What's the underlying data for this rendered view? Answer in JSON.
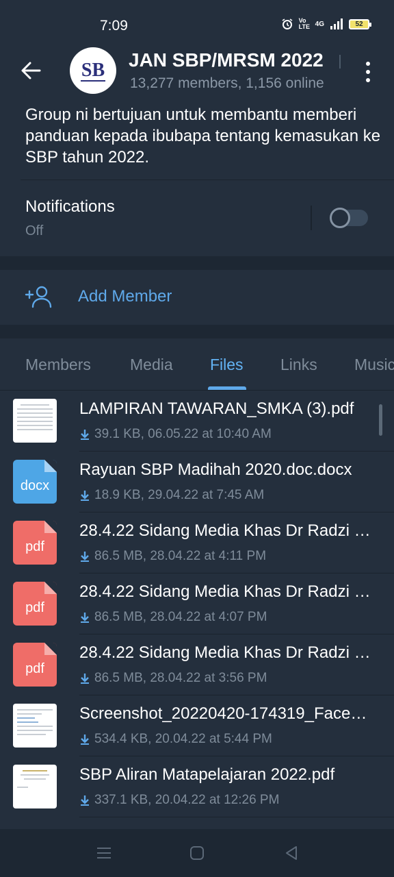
{
  "status_bar": {
    "time": "7:09",
    "network": "4G",
    "volte": "Vo LTE",
    "battery": "52"
  },
  "header": {
    "title": "JAN SBP/MRSM 2022",
    "subtitle": "13,277 members, 1,156 online",
    "avatar_text": "SB"
  },
  "info": {
    "description": "Group ni bertujuan untuk membantu memberi panduan kepada ibubapa tentang kemasukan ke SBP tahun 2022.",
    "notifications_label": "Notifications",
    "notifications_value": "Off"
  },
  "add_member": {
    "label": "Add Member"
  },
  "tabs": [
    {
      "label": "Members",
      "active": false
    },
    {
      "label": "Media",
      "active": false
    },
    {
      "label": "Files",
      "active": true
    },
    {
      "label": "Links",
      "active": false
    },
    {
      "label": "Music",
      "active": false
    }
  ],
  "files": [
    {
      "name": "LAMPIRAN TAWARAN_SMKA (3).pdf",
      "meta": "39.1 KB, 06.05.22 at 10:40 AM",
      "thumb": "doc",
      "ext": ""
    },
    {
      "name": "Rayuan SBP Madihah 2020.doc.docx",
      "meta": "18.9 KB, 29.04.22 at 7:45 AM",
      "thumb": "docx",
      "ext": "docx"
    },
    {
      "name": "28.4.22 Sidang Media Khas Dr Radzi …",
      "meta": "86.5 MB, 28.04.22 at 4:11 PM",
      "thumb": "pdf",
      "ext": "pdf"
    },
    {
      "name": "28.4.22 Sidang Media Khas Dr Radzi …",
      "meta": "86.5 MB, 28.04.22 at 4:07 PM",
      "thumb": "pdf",
      "ext": "pdf"
    },
    {
      "name": "28.4.22 Sidang Media Khas Dr Radzi …",
      "meta": "86.5 MB, 28.04.22 at 3:56 PM",
      "thumb": "pdf",
      "ext": "pdf"
    },
    {
      "name": "Screenshot_20220420-174319_Face…",
      "meta": "534.4 KB, 20.04.22 at 5:44 PM",
      "thumb": "doc",
      "ext": ""
    },
    {
      "name": "SBP Aliran Matapelajaran 2022.pdf",
      "meta": "337.1 KB, 20.04.22 at 12:26 PM",
      "thumb": "doc",
      "ext": ""
    }
  ],
  "colors": {
    "background": "#1d2733",
    "surface": "#242f3d",
    "accent": "#5fa9ea",
    "pdf": "#ef6d68",
    "docx": "#4ea6e6"
  }
}
